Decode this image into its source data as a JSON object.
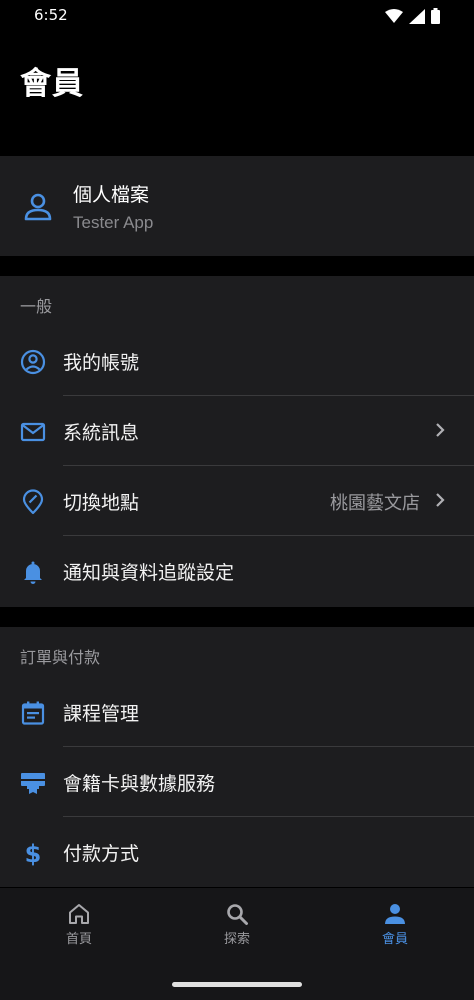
{
  "status": {
    "time": "6:52"
  },
  "header": {
    "title": "會員"
  },
  "profile": {
    "name": "個人檔案",
    "subtitle": "Tester App"
  },
  "general": {
    "header": "一般",
    "items": [
      {
        "label": "我的帳號",
        "icon": "account-circle-icon"
      },
      {
        "label": "系統訊息",
        "icon": "mail-icon"
      },
      {
        "label": "切換地點",
        "icon": "location-icon",
        "value": "桃園藝文店"
      },
      {
        "label": "通知與資料追蹤設定",
        "icon": "bell-icon"
      }
    ]
  },
  "orders": {
    "header": "訂單與付款",
    "items": [
      {
        "label": "課程管理",
        "icon": "calendar-icon"
      },
      {
        "label": "會籍卡與數據服務",
        "icon": "membership-card-icon"
      },
      {
        "label": "付款方式",
        "icon": "dollar-icon"
      }
    ]
  },
  "tabs": [
    {
      "label": "首頁",
      "icon": "home-icon"
    },
    {
      "label": "探索",
      "icon": "search-icon"
    },
    {
      "label": "會員",
      "icon": "person-icon",
      "active": true
    }
  ],
  "colors": {
    "accent": "#4a90e2",
    "background": "#000000",
    "card": "#1d1d1f"
  }
}
